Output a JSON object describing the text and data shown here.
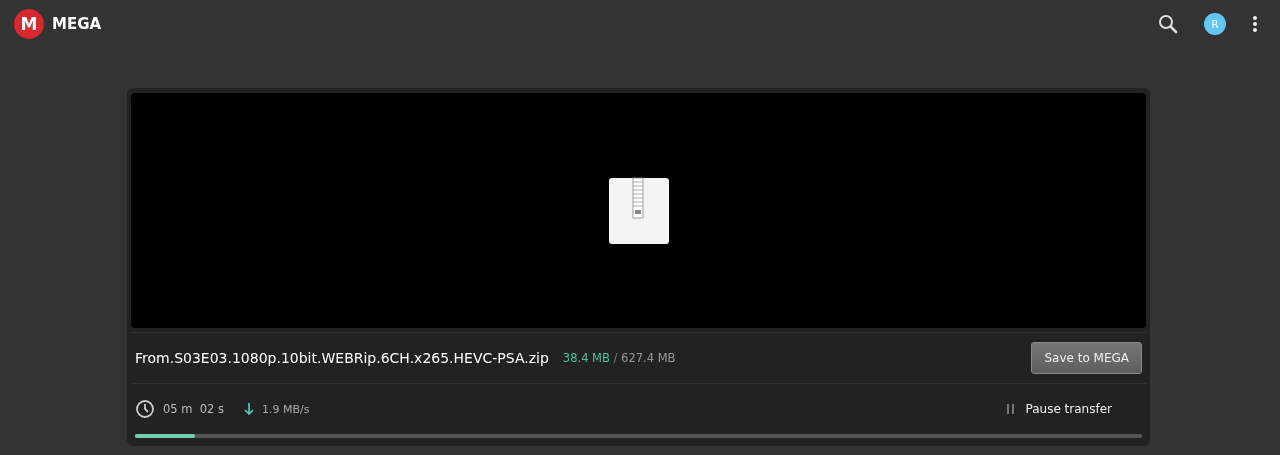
{
  "header": {
    "logo_letter": "M",
    "brand": "MEGA",
    "avatar_initial": "R"
  },
  "file": {
    "name": "From.S03E03.1080p.10bit.WEBRip.6CH.x265.HEVC-PSA.zip",
    "downloaded": "38.4 MB",
    "separator": "/",
    "total": "627.4 MB"
  },
  "save_button": "Save to MEGA",
  "transfer": {
    "time_left": "05 m  02 s",
    "speed": "1.9 MB/s",
    "pause_label": "Pause transfer",
    "level": 0.06
  }
}
